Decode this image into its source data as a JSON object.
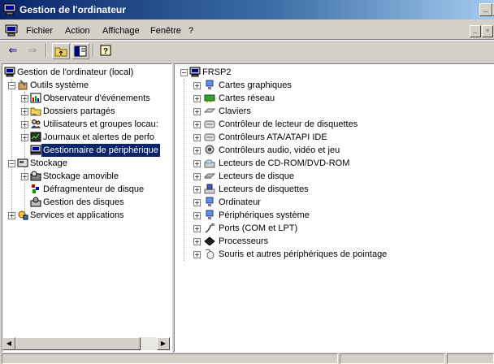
{
  "window": {
    "title": "Gestion de l'ordinateur"
  },
  "menu": {
    "items": [
      "Fichier",
      "Action",
      "Affichage",
      "Fenêtre",
      "?"
    ]
  },
  "toolbar": {
    "buttons": [
      "back-arrow-icon",
      "forward-arrow-icon",
      "up-folder-icon",
      "show-hide-tree-icon",
      "help-icon"
    ]
  },
  "left_tree": {
    "root": "Gestion de l'ordinateur (local)",
    "outils": "Outils système",
    "observateur": "Observateur d'événements",
    "dossiers": "Dossiers partagés",
    "utilisateurs": "Utilisateurs et groupes locau:",
    "journaux": "Journaux et alertes de perfo",
    "gestionnaire": "Gestionnaire de périphérique",
    "stockage": "Stockage",
    "amovible": "Stockage amovible",
    "defrag": "Défragmenteur de disque",
    "disques": "Gestion des disques",
    "services": "Services et applications"
  },
  "right_tree": {
    "root": "FRSP2",
    "items": [
      "Cartes graphiques",
      "Cartes réseau",
      "Claviers",
      "Contrôleur de lecteur de disquettes",
      "Contrôleurs ATA/ATAPI IDE",
      "Contrôleurs audio, vidéo et jeu",
      "Lecteurs de CD-ROM/DVD-ROM",
      "Lecteurs de disque",
      "Lecteurs de disquettes",
      "Ordinateur",
      "Périphériques système",
      "Ports (COM et LPT)",
      "Processeurs",
      "Souris et autres périphériques de pointage"
    ]
  },
  "colors": {
    "title_start": "#0a246a",
    "title_end": "#a6caf0",
    "selection": "#0a246a",
    "face": "#d4d0c8"
  }
}
